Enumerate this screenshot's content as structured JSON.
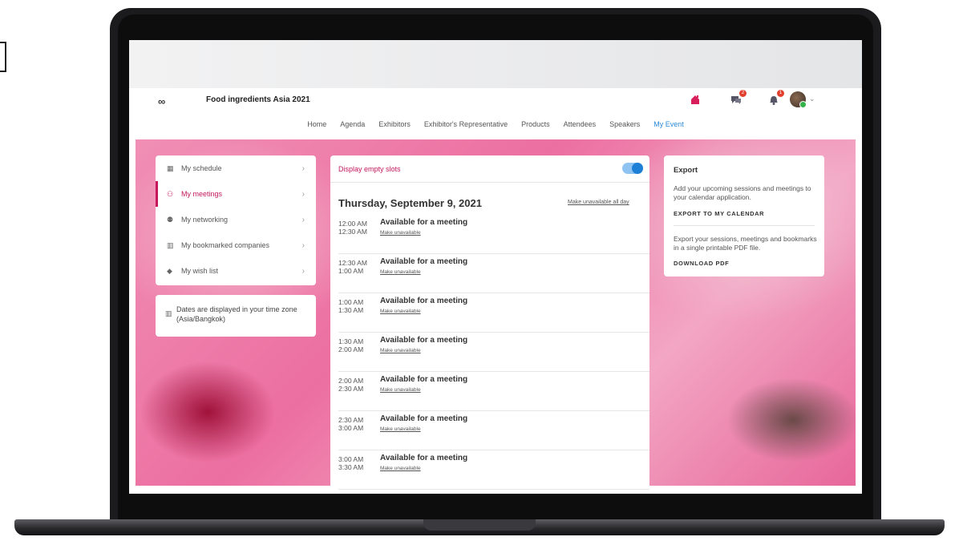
{
  "app": {
    "title": "Food ingredients Asia 2021",
    "logo_glyph": "∞"
  },
  "nav": [
    "Home",
    "Agenda",
    "Exhibitors",
    "Exhibitor's Representative",
    "Products",
    "Attendees",
    "Speakers",
    "My Event"
  ],
  "header_icons": {
    "messages_badge": "2",
    "notifications_badge": "1"
  },
  "sidebar": {
    "items": [
      {
        "label": "My schedule",
        "icon": "calendar-icon"
      },
      {
        "label": "My meetings",
        "icon": "meeting-icon"
      },
      {
        "label": "My networking",
        "icon": "people-icon"
      },
      {
        "label": "My bookmarked companies",
        "icon": "building-icon"
      },
      {
        "label": "My wish list",
        "icon": "tag-icon"
      }
    ],
    "timezone_note": "Dates are displayed in your time zone (Asia/Bangkok)"
  },
  "center": {
    "toggle_label": "Display empty slots",
    "day_title": "Thursday, September 9, 2021",
    "make_unavailable_all": "Make unavailable all day",
    "slots": [
      {
        "start": "12:00 AM",
        "end": "12:30 AM",
        "title": "Available for a meeting",
        "link": "Make unavailable"
      },
      {
        "start": "12:30 AM",
        "end": "1:00 AM",
        "title": "Available for a meeting",
        "link": "Make unavailable"
      },
      {
        "start": "1:00 AM",
        "end": "1:30 AM",
        "title": "Available for a meeting",
        "link": "Make unavailable"
      },
      {
        "start": "1:30 AM",
        "end": "2:00 AM",
        "title": "Available for a meeting",
        "link": "Make unavailable"
      },
      {
        "start": "2:00 AM",
        "end": "2:30 AM",
        "title": "Available for a meeting",
        "link": "Make unavailable"
      },
      {
        "start": "2:30 AM",
        "end": "3:00 AM",
        "title": "Available for a meeting",
        "link": "Make unavailable"
      },
      {
        "start": "3:00 AM",
        "end": "3:30 AM",
        "title": "Available for a meeting",
        "link": "Make unavailable"
      }
    ]
  },
  "export": {
    "title": "Export",
    "calendar_desc": "Add your upcoming sessions and meetings to your calendar application.",
    "calendar_link": "EXPORT TO MY CALENDAR",
    "pdf_desc": "Export your sessions, meetings and bookmarks in a single printable PDF file.",
    "pdf_link": "DOWNLOAD PDF"
  },
  "colors": {
    "accent": "#c4175c",
    "link_blue": "#2b8ad8",
    "toggle": "#1e7fd6"
  }
}
